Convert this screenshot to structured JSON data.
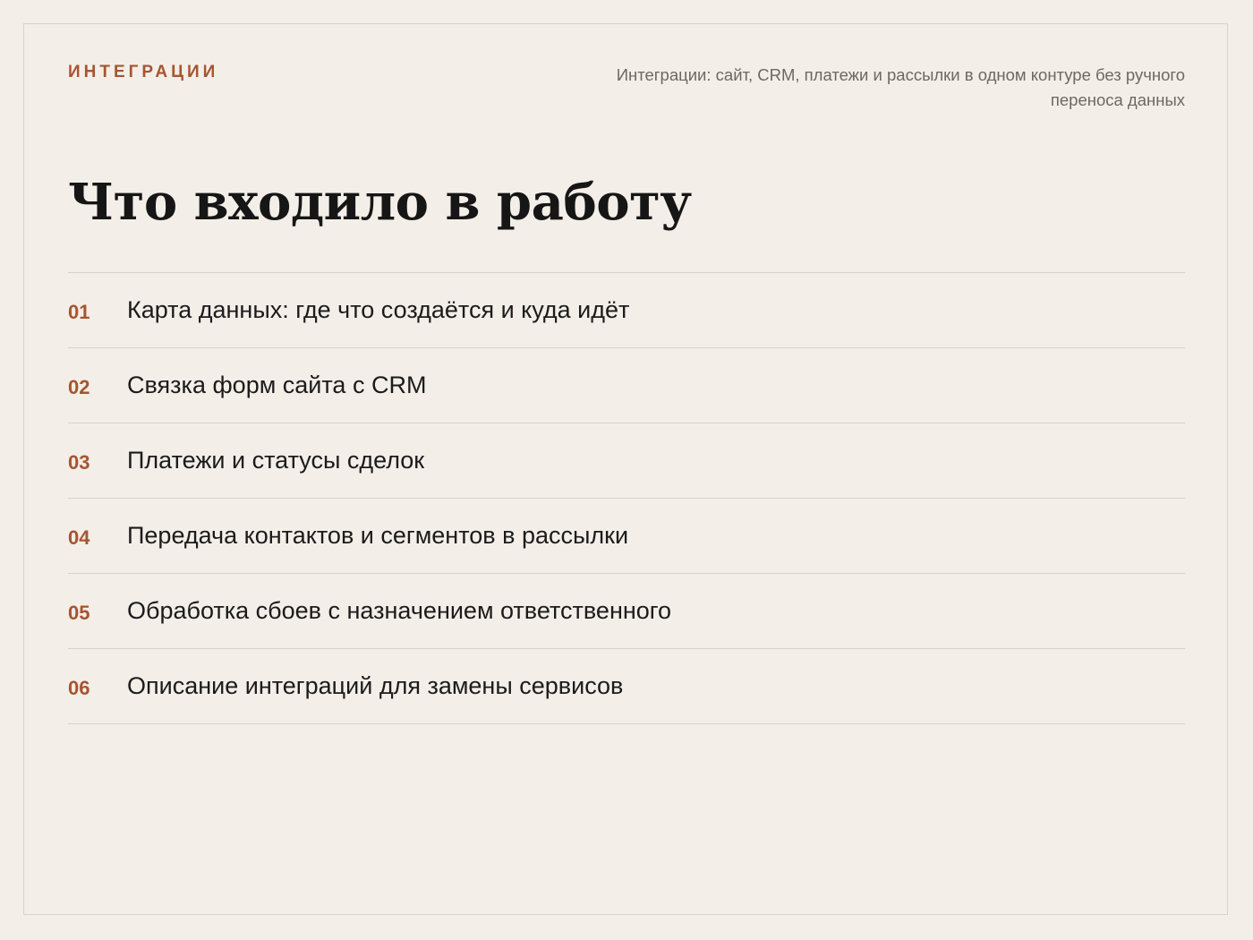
{
  "header": {
    "eyebrow": "ИНТЕГРАЦИИ",
    "subtitle": "Интеграции: сайт, CRM, платежи и рассылки в одном контуре без ручного переноса данных"
  },
  "title": "Что входило в работу",
  "items": [
    {
      "num": "01",
      "text": "Карта данных: где что создаётся и куда идёт"
    },
    {
      "num": "02",
      "text": "Связка форм сайта с CRM"
    },
    {
      "num": "03",
      "text": "Платежи и статусы сделок"
    },
    {
      "num": "04",
      "text": "Передача контактов и сегментов в рассылки"
    },
    {
      "num": "05",
      "text": "Обработка сбоев с назначением ответственного"
    },
    {
      "num": "06",
      "text": "Описание интеграций для замены сервисов"
    }
  ],
  "colors": {
    "background": "#f3eee8",
    "accent": "#a65530",
    "text": "#1b1b1b",
    "muted": "#6d6863",
    "divider": "#d8d2cb"
  }
}
